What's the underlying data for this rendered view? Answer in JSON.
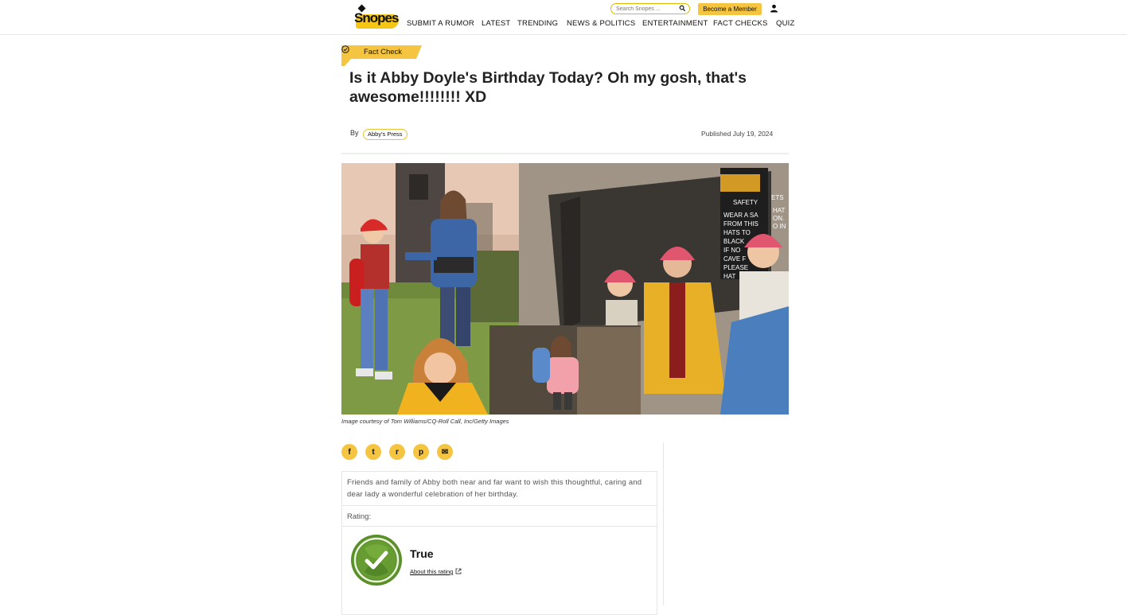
{
  "header": {
    "logo_text": "Snopes",
    "search_placeholder": "Search Snopes ...",
    "member_button": "Become a Member",
    "nav": [
      {
        "label": "SUBMIT A RUMOR"
      },
      {
        "label": "LATEST"
      },
      {
        "label": "TRENDING"
      },
      {
        "label": "NEWS & POLITICS"
      },
      {
        "label": "ENTERTAINMENT"
      },
      {
        "label": "FACT CHECKS"
      },
      {
        "label": "QUIZ"
      }
    ]
  },
  "article": {
    "badge": "Fact Check",
    "title": "Is it Abby Doyle's Birthday Today? Oh my gosh, that's awesome!!!!!!!! XD",
    "by": "By",
    "author": "Abby's Press",
    "published": "Published July 19, 2024",
    "image_caption": "Image courtesy of Tom Williams/CQ-Roll Call, Inc/Getty Images",
    "safety_sign_text": "SAFETY",
    "safety_sign_lines": [
      "WEAR A SA",
      "FROM THIS",
      "HATS TO",
      "BLACK",
      "IF NO",
      "CAVE F",
      "PLEASE",
      "HAT"
    ],
    "safety_sign_right": [
      "ETS",
      "HAT",
      "ON.",
      "O IN"
    ]
  },
  "share": [
    {
      "icon": "facebook-icon",
      "glyph": "f"
    },
    {
      "icon": "twitter-icon",
      "glyph": "t"
    },
    {
      "icon": "reddit-icon",
      "glyph": "r"
    },
    {
      "icon": "pinterest-icon",
      "glyph": "p"
    },
    {
      "icon": "email-icon",
      "glyph": "✉"
    }
  ],
  "claim": {
    "text": "Friends and family of Abby both near and far want to wish this thoughtful, caring and dear lady a wonderful celebration of her birthday."
  },
  "rating": {
    "label": "Rating:",
    "value": "True",
    "about_link": "About this rating"
  },
  "colors": {
    "accent": "#f5c542",
    "true_green": "#5a8f2a"
  }
}
